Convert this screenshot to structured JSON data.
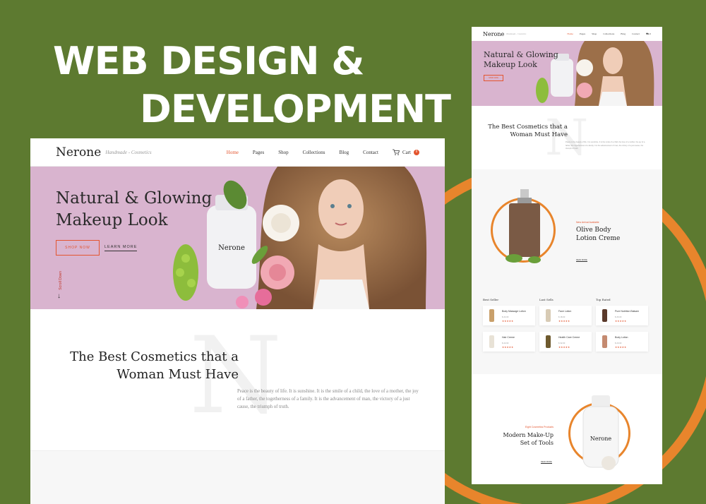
{
  "headline": {
    "line1": "WEB DESIGN &",
    "line2": "DEVELOPMENT"
  },
  "colors": {
    "background": "#5d7a30",
    "accent": "#e3552f",
    "ring": "#e8852c",
    "hero": "#d9b4cf"
  },
  "site": {
    "logo": "Nerone",
    "tagline": "Handmade - Cosmetics",
    "nav": [
      "Home",
      "Pages",
      "Shop",
      "Collections",
      "Blog",
      "Contact"
    ],
    "cart_label": "Cart",
    "cart_count": "0"
  },
  "hero": {
    "title_line1": "Natural & Glowing",
    "title_line2": "Makeup Look",
    "shop_button": "SHOP NOW",
    "learn_button": "LEARN MORE",
    "scroll_label": "Scroll Down",
    "bottle_label": "Nerone"
  },
  "intro": {
    "big_letter": "N",
    "title_line1": "The Best Cosmetics that a",
    "title_line2": "Woman Must Have",
    "text": "Peace is the beauty of life. It is sunshine. It is the smile of a child, the love of a mother, the joy of a father, the togetherness of a family. It is the advancement of man, the victory of a just cause, the triumph of truth."
  },
  "feature": {
    "eyebrow": "New Arrival Available",
    "title_line1": "Olive Body",
    "title_line2": "Lotion Creme",
    "read_more": "READ MORE"
  },
  "product_columns": [
    {
      "heading": "Best Seller",
      "items": [
        {
          "name": "Body Massage Lotion",
          "price": "$ 24.00",
          "stars": "★★★★★",
          "color": "#c9a06b"
        },
        {
          "name": "Hair Creme",
          "price": "$ 22.00",
          "stars": "★★★★★",
          "color": "#e8e2d6"
        }
      ]
    },
    {
      "heading": "Last Sells",
      "items": [
        {
          "name": "Face Lotion",
          "price": "$ 18.00",
          "stars": "★★★★★",
          "color": "#d8cbb5"
        },
        {
          "name": "Health Care Creme",
          "price": "$ 32.00",
          "stars": "★★★★★",
          "color": "#6e5a2e"
        }
      ]
    },
    {
      "heading": "Top Rated",
      "items": [
        {
          "name": "Pure Nutrition Balsam",
          "price": "$ 26.00",
          "stars": "★★★★★",
          "color": "#5b3a2b"
        },
        {
          "name": "Body Lotion",
          "price": "$ 20.00",
          "stars": "★★★★★",
          "color": "#c48a70"
        }
      ]
    }
  ],
  "tools": {
    "eyebrow": "Eight Cosmetics Products",
    "title_line1": "Modern Make-Up",
    "title_line2": "Set of Tools",
    "read_more": "READ MORE",
    "bottle_label": "Nerone"
  }
}
